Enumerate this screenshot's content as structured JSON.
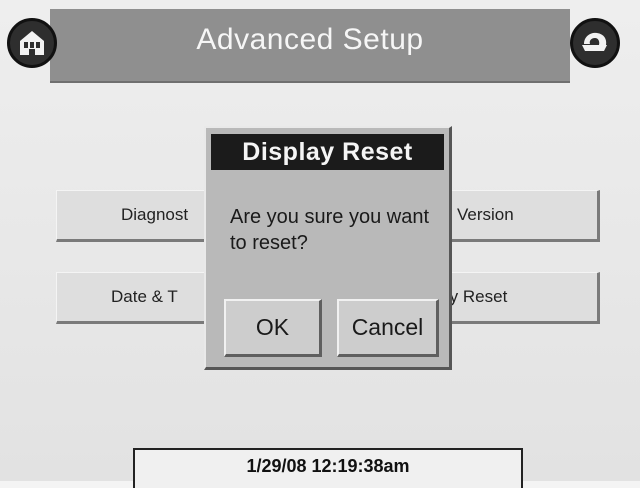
{
  "header": {
    "title": "Advanced Setup",
    "left_icon": "home-icon",
    "right_icon": "back-icon"
  },
  "menu": {
    "diagnostics_label": "Diagnost",
    "date_time_label": "Date & T",
    "version_label": "Version",
    "display_reset_label": "play Reset"
  },
  "dialog": {
    "title": "Display Reset",
    "message": "Are you sure you want to reset?",
    "ok_label": "OK",
    "cancel_label": "Cancel"
  },
  "status": {
    "datetime": "1/29/08  12:19:38am"
  },
  "colors": {
    "header_bg": "#8f8f8f",
    "dialog_title_bg": "#1b1b1b",
    "dialog_bg": "#b9b9b9"
  }
}
